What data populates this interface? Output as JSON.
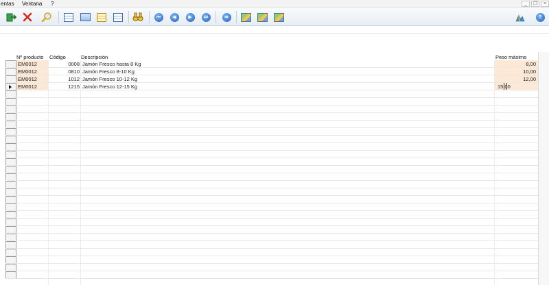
{
  "menu": {
    "items": [
      "entas",
      "Ventana",
      "?"
    ]
  },
  "window_controls": [
    "_",
    "❐",
    "×"
  ],
  "toolbar": {
    "icons": [
      "exit-icon",
      "cancel-icon",
      "search-icon",
      "grid-view-icon",
      "form-view-icon",
      "edit-grid-icon",
      "table-grid-icon",
      "binoculars-icon",
      "first-record-icon",
      "previous-record-icon",
      "next-record-icon",
      "last-record-icon",
      "go-icon",
      "export-icon",
      "export-excel-icon",
      "import-icon",
      "chart-icon",
      "help-icon"
    ]
  },
  "grid": {
    "headers": {
      "producto": "Nº producto",
      "codigo": "Código",
      "descripcion": "Descripción",
      "peso": "Peso máximo"
    },
    "rows": [
      {
        "producto": "EM0012",
        "codigo": "0008",
        "descripcion": "Jamón Fresco hasta 8 Kg",
        "peso": "8,00"
      },
      {
        "producto": "EM0012",
        "codigo": "0810",
        "descripcion": "Jamón Fresco 8-10 Kg",
        "peso": "10,00"
      },
      {
        "producto": "EM0012",
        "codigo": "1012",
        "descripcion": "Jamón Fresco 10-12 Kg",
        "peso": "12,00"
      },
      {
        "producto": "EM0012",
        "codigo": "1215",
        "descripcion": "Jamón Fresco 12-15 Kg",
        "peso": "15,00"
      }
    ],
    "active_row": 3
  },
  "colors": {
    "highlight_cell": "#fde8d6",
    "toolbar_blue": "#1f5fb8"
  }
}
